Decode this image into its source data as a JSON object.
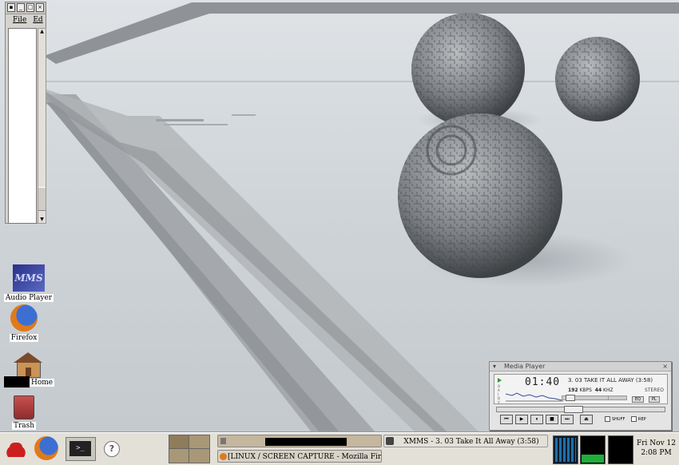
{
  "editor_window": {
    "menu": [
      "File",
      "Ed"
    ]
  },
  "desktop_icons": [
    {
      "name": "audio-player-icon",
      "label": "Audio Player",
      "badge": "MMS"
    },
    {
      "name": "firefox-icon",
      "label": "Firefox"
    },
    {
      "name": "home-icon",
      "label": "Home"
    },
    {
      "name": "trash-icon",
      "label": "Trash"
    }
  ],
  "media_player": {
    "title": "Media Player",
    "time": "01:40",
    "song": "3. 03 TAKE IT ALL AWAY (3:58)",
    "kbps": "192",
    "kbps_label": "KBPS",
    "khz": "44",
    "khz_label": "KHZ",
    "channel": "STEREO",
    "eq_label": "EQ",
    "pl_label": "PL",
    "shuffle_label": "SHUFF",
    "repeat_label": "REP"
  },
  "taskbar": {
    "task_xmms": "XMMS - 3. 03 Take It All Away (3:58)",
    "task_firefox": "[LINUX / SCREEN CAPTURE - Mozilla Firefox]",
    "clock_day": "Fri Nov 12",
    "clock_time": "2:08 PM",
    "help_label": "?"
  },
  "colors": {
    "accent_green": "#1fae3c",
    "monitor_blue": "#1e6ea8",
    "redhat_red": "#cc1f1f"
  }
}
